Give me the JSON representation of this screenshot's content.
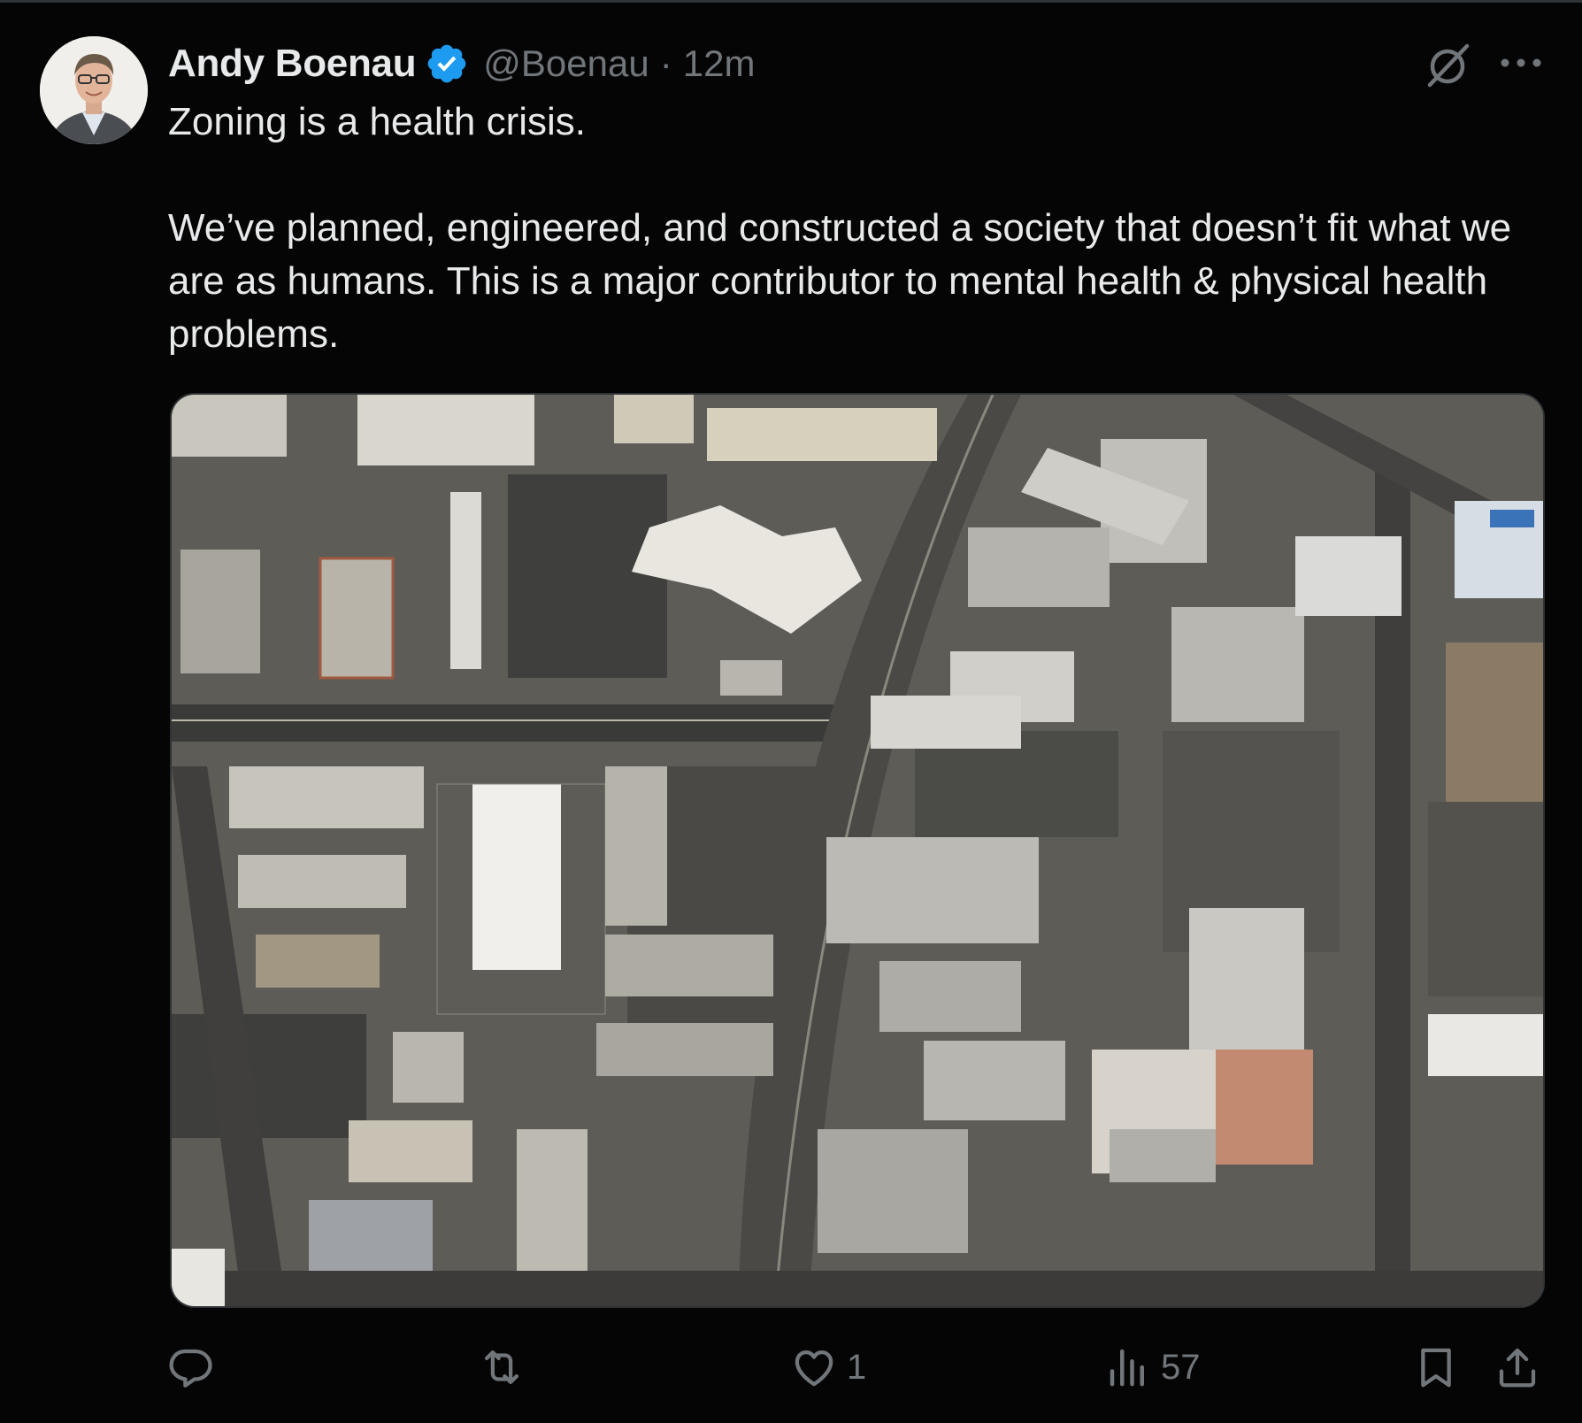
{
  "author": {
    "name": "Andy Boenau",
    "handle": "@Boenau",
    "separator": "·",
    "time": "12m",
    "verified": true
  },
  "tweet": {
    "paragraphs": [
      "Zoning is a health crisis.",
      "We’ve planned, engineered, and constructed a society that doesn’t fit what we are as humans. This is a major contributor to mental health & physical health problems."
    ]
  },
  "actions": {
    "reply_count": "",
    "repost_count": "",
    "like_count": "1",
    "views_count": "57"
  },
  "icons": [
    "verified-badge-icon",
    "grok-icon",
    "more-icon",
    "reply-icon",
    "repost-icon",
    "like-icon",
    "views-icon",
    "bookmark-icon",
    "share-icon"
  ],
  "colors": {
    "background": "#050505",
    "text": "#e7e9ea",
    "muted": "#71767b",
    "verified": "#1d9bf0"
  }
}
